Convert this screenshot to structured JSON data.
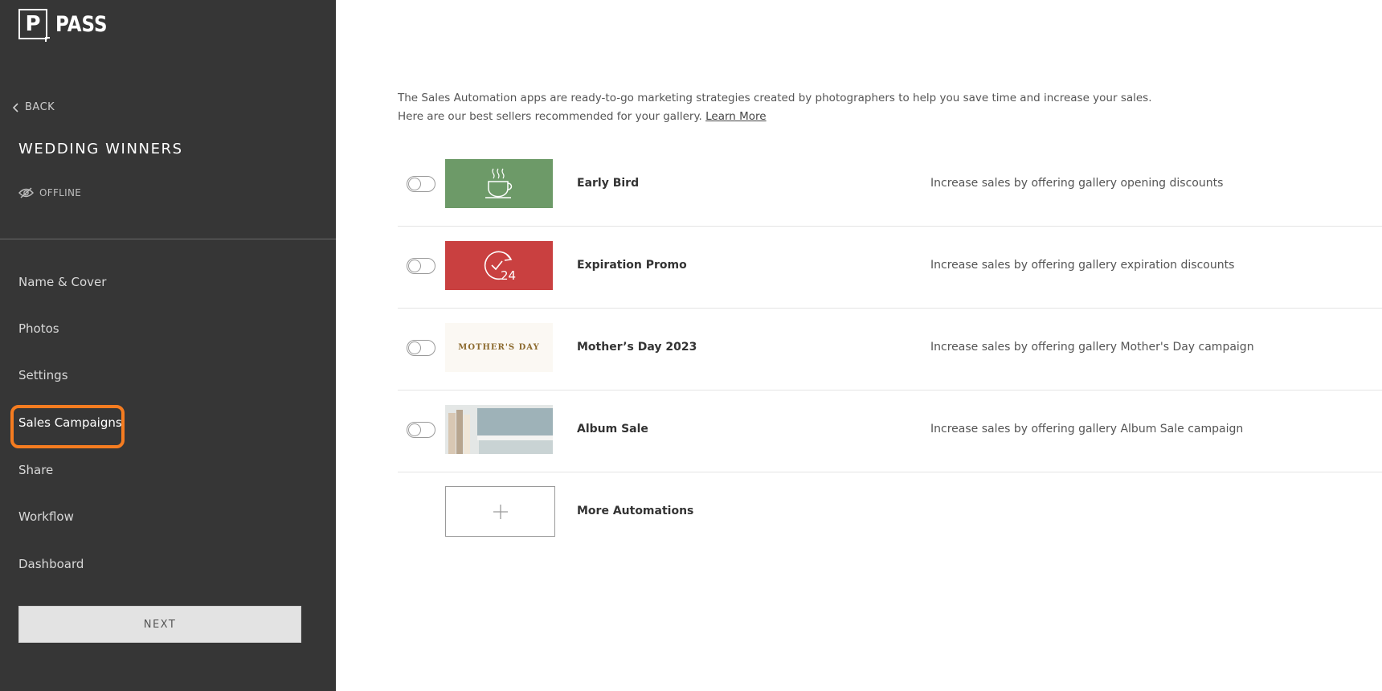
{
  "brand": {
    "logo_letter": "P",
    "logo_text": "PASS"
  },
  "sidebar": {
    "back_label": "BACK",
    "gallery_title": "WEDDING WINNERS",
    "status_label": "OFFLINE",
    "nav": [
      {
        "label": "Name & Cover"
      },
      {
        "label": "Photos"
      },
      {
        "label": "Settings"
      },
      {
        "label": "Sales Campaigns",
        "active": true
      },
      {
        "label": "Share"
      },
      {
        "label": "Workflow"
      },
      {
        "label": "Dashboard"
      }
    ],
    "next_label": "NEXT"
  },
  "main": {
    "intro_line1": "The Sales Automation apps are ready-to-go marketing strategies created by photographers to help you save time and increase your sales.",
    "intro_line2": "Here are our best sellers recommended for your gallery.",
    "learn_more": "Learn More",
    "campaigns": [
      {
        "title": "Early Bird",
        "description": "Increase sales by offering gallery opening discounts",
        "enabled": false,
        "thumb_icon": "coffee-cup-icon"
      },
      {
        "title": "Expiration Promo",
        "description": "Increase sales by offering gallery expiration discounts",
        "enabled": false,
        "thumb_icon": "24-hour-clock-icon",
        "thumb_text": "24"
      },
      {
        "title": "Mother’s Day 2023",
        "description": "Increase sales by offering gallery Mother's Day campaign",
        "enabled": false,
        "thumb_text": "MOTHER'S DAY"
      },
      {
        "title": "Album Sale",
        "description": "Increase sales by offering gallery Album Sale campaign",
        "enabled": false,
        "thumb_icon": "album-photo"
      }
    ],
    "more": {
      "label": "More Automations",
      "icon": "plus-icon"
    }
  },
  "colors": {
    "sidebar_bg": "#363636",
    "highlight": "#f57c20",
    "early_bird_bg": "#6d9a68",
    "expiration_bg": "#c94040"
  }
}
